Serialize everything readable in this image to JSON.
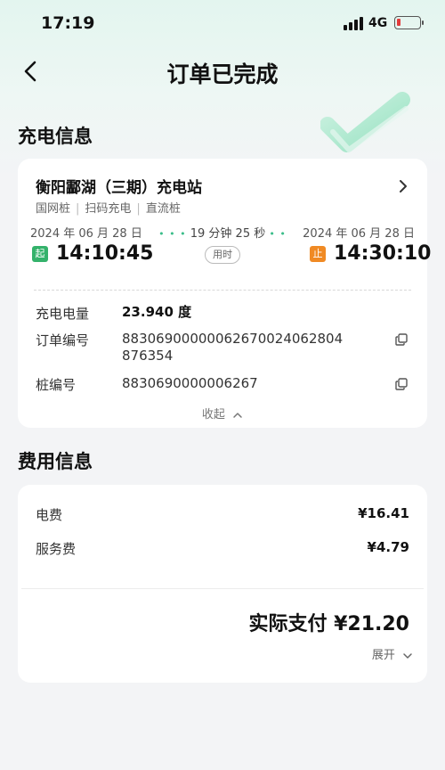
{
  "status": {
    "time": "17:19",
    "network": "4G"
  },
  "nav": {
    "title": "订单已完成"
  },
  "charging_section": {
    "title": "充电信息"
  },
  "station": {
    "name": "衡阳酃湖（三期）充电站",
    "tags": [
      "国网桩",
      "扫码充电",
      "直流桩"
    ]
  },
  "session": {
    "start_date": "2024 年 06 月 28 日",
    "end_date": "2024 年 06 月 28 日",
    "duration": "19 分钟 25 秒",
    "duration_label": "用时",
    "start_tag": "起",
    "end_tag": "止",
    "start_time": "14:10:45",
    "end_time": "14:30:10"
  },
  "details": {
    "energy_label": "充电电量",
    "energy_value": "23.940 度",
    "order_label": "订单编号",
    "order_value_line1": "883069000000626700240628​04",
    "order_value_line2": "876354",
    "pile_label": "桩编号",
    "pile_value": "8830690000006267",
    "collapse_label": "收起"
  },
  "fee_section": {
    "title": "费用信息"
  },
  "fees": {
    "electricity_label": "电费",
    "electricity_value": "¥16.41",
    "service_label": "服务费",
    "service_value": "¥4.79",
    "total_text": "实际支付 ¥21.20",
    "expand_label": "展开"
  },
  "colors": {
    "accent_green": "#34b26b",
    "end_orange": "#f08a24",
    "battery_red": "#e23b3b"
  }
}
